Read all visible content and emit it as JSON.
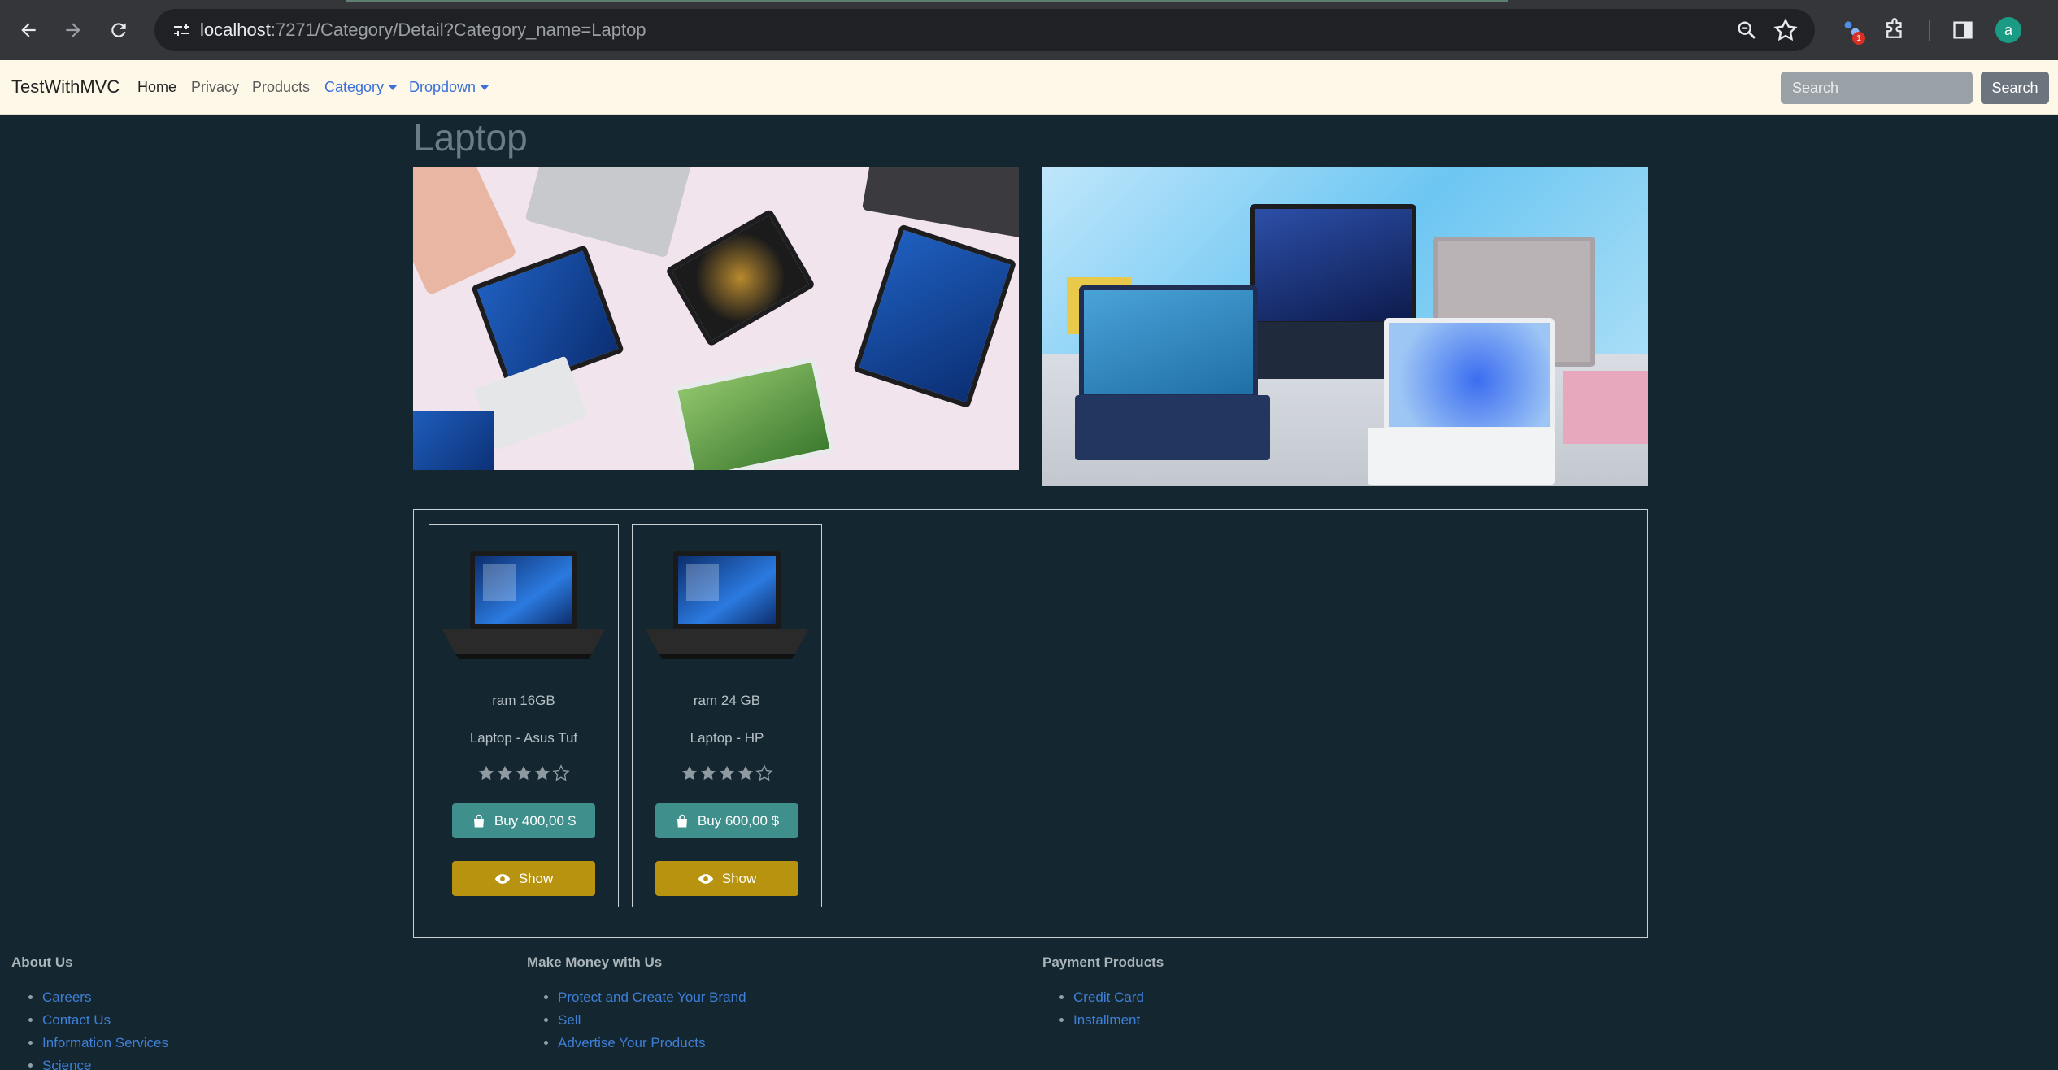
{
  "browser": {
    "url_host": "localhost",
    "url_rest": ":7271/Category/Detail?Category_name=Laptop",
    "extension_badge": "1",
    "profile_initial": "a"
  },
  "navbar": {
    "brand": "TestWithMVC",
    "links": [
      "Home",
      "Privacy",
      "Products"
    ],
    "dropdowns": [
      "Category",
      "Dropdown"
    ],
    "search_placeholder": "Search",
    "search_button": "Search"
  },
  "page": {
    "title": "Laptop"
  },
  "products": [
    {
      "spec": "ram 16GB",
      "name": "Laptop - Asus Tuf",
      "rating": 4,
      "max_rating": 5,
      "buy_label": "Buy 400,00 $",
      "show_label": "Show"
    },
    {
      "spec": "ram 24 GB",
      "name": "Laptop - HP",
      "rating": 4,
      "max_rating": 5,
      "buy_label": "Buy 600,00 $",
      "show_label": "Show"
    }
  ],
  "footer": {
    "columns": [
      {
        "title": "About Us",
        "links": [
          "Careers",
          "Contact Us",
          "Information Services",
          "Science"
        ]
      },
      {
        "title": "Make Money with Us",
        "links": [
          "Protect and Create Your Brand",
          "Sell",
          "Advertise Your Products"
        ]
      },
      {
        "title": "Payment Products",
        "links": [
          "Credit Card",
          "Installment"
        ]
      }
    ]
  },
  "colors": {
    "page_bg": "#14262f",
    "navbar_bg": "#fdf8e8",
    "buy_button": "#3f8f8c",
    "show_button": "#b7930f",
    "link": "#3f7fd6"
  }
}
